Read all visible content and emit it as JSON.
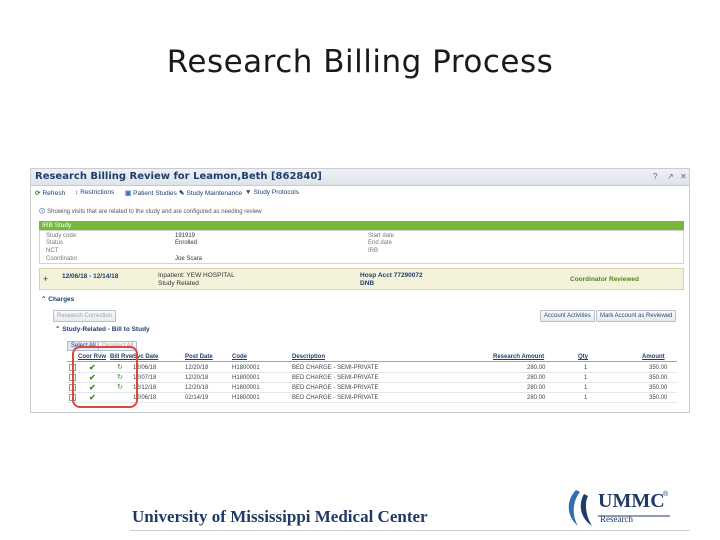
{
  "slide": {
    "title": "Research Billing Process",
    "footer": "University of Mississippi Medical Center",
    "logo": {
      "word": "UMMC",
      "registered": "®",
      "sub": "Research"
    }
  },
  "window": {
    "title": "Research Billing Review for Leamon,Beth [862840]",
    "controls": {
      "help": "?",
      "expand": "↗",
      "close": "✕"
    }
  },
  "toolbar": {
    "refresh": "Refresh",
    "restrictions": "Restrictions",
    "patient_studies": "Patient Studies",
    "study_maintenance": "Study Maintenance",
    "study_protocols": "Study Protocols"
  },
  "info_text": "Showing visits that are related to the study and are configured as needing review",
  "irb": {
    "header": "IRB  Study",
    "study_code_label": "Study code:",
    "study_code": "191919",
    "status_label": "Status",
    "status": "Enrolled",
    "nct_label": "NCT",
    "coordinator_label": "Coordinator",
    "coordinator": "Joe Scara",
    "start_date_label": "Start date",
    "end_date_label": "End date",
    "irb_label": "IRB"
  },
  "encounter": {
    "dates": "12/06/18 - 12/14/18",
    "setting": "Inpatient: YEW HOSPITAL",
    "relation": "Study Related",
    "hosp_acct": "Hosp Acct 77290072",
    "class": "DNB",
    "status": "Coordinator Reviewed"
  },
  "charges": {
    "label": "Charges",
    "research_correction": "Research Correction",
    "account_activities": "Account Activities",
    "mark_reviewed": "Mark Account as Reviewed",
    "group_label": "Study-Related - Bill to Study",
    "select_all": "Select All",
    "deselect_all": "Deselect All",
    "columns": [
      "Coor Rvw",
      "Bill Rvw",
      "Svc Date",
      "Post Date",
      "Code",
      "Description",
      "Research Amount",
      "Qty",
      "Amount"
    ],
    "rows": [
      {
        "svc_date": "12/06/18",
        "post_date": "12/20/18",
        "code": "H1800001",
        "description": "BED CHARGE - SEMI-PRIVATE",
        "research_amount": "280.00",
        "qty": "1",
        "amount": "350.00"
      },
      {
        "svc_date": "12/07/18",
        "post_date": "12/20/18",
        "code": "H1800001",
        "description": "BED CHARGE - SEMI-PRIVATE",
        "research_amount": "280.00",
        "qty": "1",
        "amount": "350.00"
      },
      {
        "svc_date": "12/12/18",
        "post_date": "12/20/18",
        "code": "H1800001",
        "description": "BED CHARGE - SEMI-PRIVATE",
        "research_amount": "280.00",
        "qty": "1",
        "amount": "350.00"
      },
      {
        "svc_date": "12/06/18",
        "post_date": "02/14/19",
        "code": "H1800001",
        "description": "BED CHARGE - SEMI-PRIVATE",
        "research_amount": "280.00",
        "qty": "1",
        "amount": "350.00"
      }
    ]
  },
  "colors": {
    "irb_green": "#76b93a",
    "highlight_red": "#e0453e",
    "brand_navy": "#1f3b66"
  },
  "icons": [
    "refresh-icon",
    "restrictions-icon",
    "patient-studies-icon",
    "study-maintenance-icon",
    "study-protocols-icon",
    "info-icon",
    "check-icon",
    "bill-review-icon"
  ]
}
